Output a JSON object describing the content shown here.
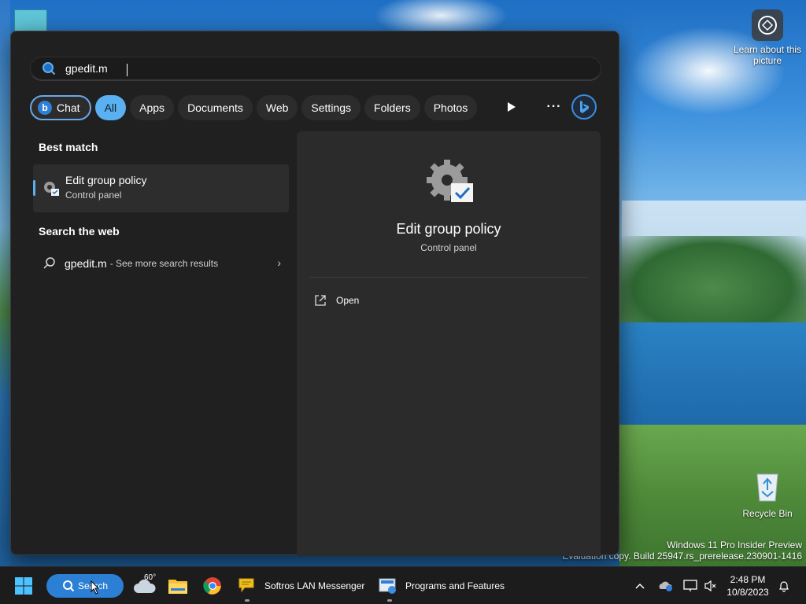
{
  "desktop": {
    "learn_label": "Learn about this picture",
    "recycle_label": "Recycle Bin",
    "watermark_line1": "Windows 11 Pro Insider Preview",
    "watermark_line2": "Evaluation copy. Build 25947.rs_prerelease.230901-1416"
  },
  "search": {
    "query": "gpedit.m",
    "filters": [
      "Chat",
      "All",
      "Apps",
      "Documents",
      "Web",
      "Settings",
      "Folders",
      "Photos"
    ],
    "active_filter": "All"
  },
  "results": {
    "best_match_label": "Best match",
    "best_match": {
      "title": "Edit group policy",
      "subtitle": "Control panel"
    },
    "web_label": "Search the web",
    "web_item": {
      "query": "gpedit.m",
      "more": "- See more search results"
    }
  },
  "detail": {
    "title": "Edit group policy",
    "subtitle": "Control panel",
    "action_open": "Open"
  },
  "taskbar": {
    "search_label": "Search",
    "weather_temp": "60°",
    "messenger_label": "Softros LAN Messenger",
    "programs_label": "Programs and Features",
    "time": "2:48 PM",
    "date": "10/8/2023"
  },
  "colors": {
    "accent": "#5ab0f0",
    "panel_bg": "#202020",
    "taskbar_bg": "#1c1c1c"
  }
}
